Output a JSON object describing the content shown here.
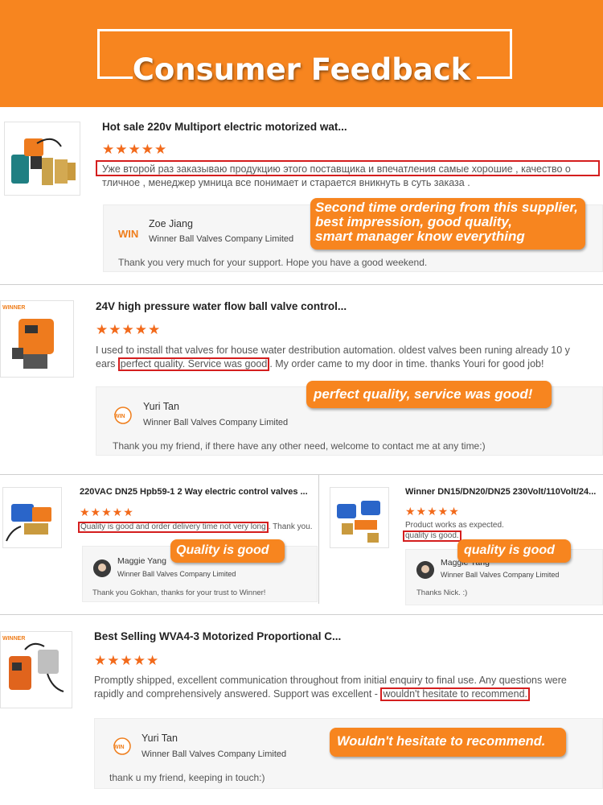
{
  "header": {
    "title": "Consumer Feedback"
  },
  "colors": {
    "accent": "#f7851f",
    "star": "#f26a1b",
    "highlight": "#d41e1e"
  },
  "stars": "★★★★★",
  "reviews": [
    {
      "product_title": "Hot sale 220v Multiport electric motorized wat...",
      "text_line1": "Уже второй раз заказываю продукцию этого поставщика и впечатления самые хорошие , качество о",
      "text_line2": "тличное , менеджер умница все понимает и старается вникнуть в суть заказа .",
      "reply_name": "Zoe Jiang",
      "reply_company": "Winner Ball Valves Company Limited",
      "reply_message": "Thank you very much for your support. Hope you have a good weekend.",
      "callout": [
        "Second time ordering from this supplier,",
        "best impression, good quality,",
        "smart manager know everything"
      ]
    },
    {
      "product_title": "24V high pressure water flow ball valve control...",
      "text_line1": "I used to install that valves for house water destribution automation. oldest valves been runing already 10 y",
      "text_line2_a": "ears ",
      "text_line2_hl": "perfect quality. Service was good",
      "text_line2_b": ". My order came to my door in time. thanks Youri for good job!",
      "reply_name": "Yuri Tan",
      "reply_company": "Winner Ball Valves Company Limited",
      "reply_message": "Thank you my friend, if there have any other need, welcome to contact me at any time:)",
      "callout": [
        "perfect quality, service was good!"
      ]
    },
    {
      "product_title": "220VAC DN25 Hpb59-1 2 Way electric control valves ...",
      "text_hl": "Quality is good and order delivery time not very long",
      "text_rest": ". Thank you.",
      "reply_name": "Maggie Yang",
      "reply_company": "Winner Ball Valves Company Limited",
      "reply_message": "Thank you Gokhan, thanks for your trust to Winner!",
      "callout": [
        "Quality is good"
      ]
    },
    {
      "product_title": "Winner DN15/DN20/DN25 230Volt/110Volt/24...",
      "text_line1": "Product works as expected.",
      "text_hl": "quality is good.",
      "reply_name": "Maggie Yang",
      "reply_company": "Winner Ball Valves Company Limited",
      "reply_message": "Thanks Nick. :)",
      "callout": [
        "quality is good"
      ]
    },
    {
      "product_title": "Best Selling WVA4-3 Motorized Proportional C...",
      "text_line1": "Promptly shipped, excellent communication throughout from initial enquiry to final use. Any questions were",
      "text_line2_a": "rapidly and comprehensively answered. Support was excellent - ",
      "text_line2_hl": "wouldn't hesitate to recommend.",
      "reply_name": "Yuri Tan",
      "reply_company": "Winner Ball Valves Company Limited",
      "reply_message": "thank u my friend, keeping  in touch:)",
      "callout": [
        "Wouldn't hesitate to recommend."
      ]
    }
  ]
}
